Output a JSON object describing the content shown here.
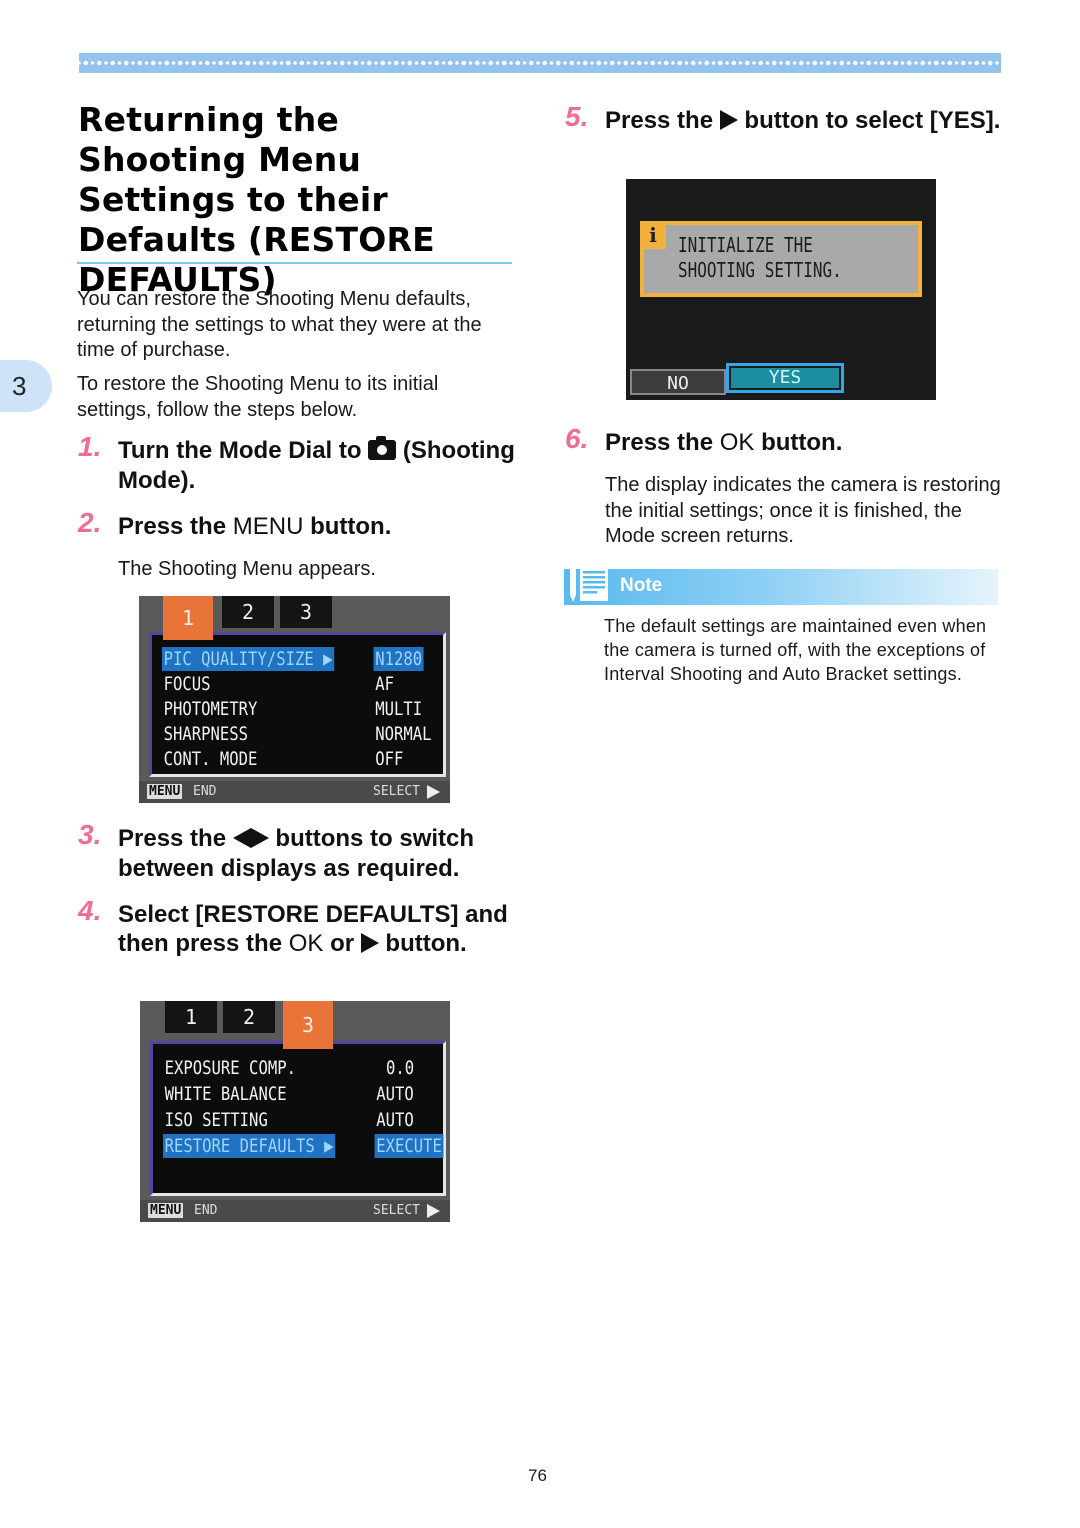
{
  "page": {
    "title": "Returning the Shooting Menu Settings to their Defaults (RESTORE DEFAULTS)",
    "chapter_tab": "3",
    "page_number": "76"
  },
  "intro": {
    "p1": "You can restore the Shooting Menu defaults, returning the settings to what they were at the time of purchase.",
    "p2": "To restore the Shooting Menu to its initial settings, follow the steps below."
  },
  "steps": [
    {
      "num": "1.",
      "text_a": "Turn the Mode Dial to",
      "icon": "camera-icon",
      "text_b": "(Shooting Mode)."
    },
    {
      "num": "2.",
      "text_a": "Press the",
      "key": "MENU",
      "text_b": "button.",
      "sub": "The Shooting Menu appears."
    },
    {
      "num": "3.",
      "text_a": "Press the",
      "icon": "left-right-arrows-icon",
      "text_b": "buttons to switch between displays as required."
    },
    {
      "num": "4.",
      "text_a": "Select  [RESTORE DEFAULTS] and then press the",
      "key": "OK",
      "text_or": "or",
      "icon": "right-arrow-icon",
      "text_b": "button."
    },
    {
      "num": "5.",
      "text_a": "Press the",
      "icon": "right-arrow-icon",
      "text_b": "button to select [YES]."
    },
    {
      "num": "6.",
      "text_a": "Press the",
      "key": "OK",
      "text_b": "button.",
      "sub": "The display indicates the camera is restoring the initial settings; once it is finished, the Mode screen returns."
    }
  ],
  "screen1": {
    "tabs": [
      "1",
      "2",
      "3"
    ],
    "active_tab": "1",
    "rows": [
      {
        "label": "PIC QUALITY/SIZE ▶",
        "value": "N1280",
        "selected": true
      },
      {
        "label": "FOCUS",
        "value": "AF"
      },
      {
        "label": "PHOTOMETRY",
        "value": "MULTI"
      },
      {
        "label": "SHARPNESS",
        "value": "NORMAL"
      },
      {
        "label": "CONT. MODE",
        "value": "OFF"
      }
    ],
    "footer": {
      "menu_key": "MENU",
      "end": "END",
      "select": "SELECT"
    }
  },
  "screen2": {
    "tabs": [
      "1",
      "2",
      "3"
    ],
    "active_tab": "3",
    "rows": [
      {
        "label": "EXPOSURE COMP.",
        "value": "0.0"
      },
      {
        "label": "WHITE BALANCE",
        "value": "AUTO"
      },
      {
        "label": "ISO SETTING",
        "value": "AUTO"
      },
      {
        "label": "RESTORE DEFAULTS ▶",
        "value": "EXECUTE",
        "selected": true
      }
    ],
    "footer": {
      "menu_key": "MENU",
      "end": "END",
      "select": "SELECT"
    }
  },
  "dialog": {
    "info_glyph": "i",
    "line1": "INITIALIZE THE",
    "line2": "SHOOTING SETTING.",
    "no": "NO",
    "yes": "YES",
    "selected": "YES"
  },
  "note": {
    "title": "Note",
    "text": "The default settings are maintained even when the camera is turned off, with the exceptions of Interval Shooting and Auto Bracket settings."
  },
  "colors": {
    "step_number": "#ef6d8e",
    "accent_blue": "#7cc8ee",
    "screen_tab_active": "#e8743a",
    "screen_selection": "#1f73c2",
    "dialog_border": "#f1b13a"
  }
}
